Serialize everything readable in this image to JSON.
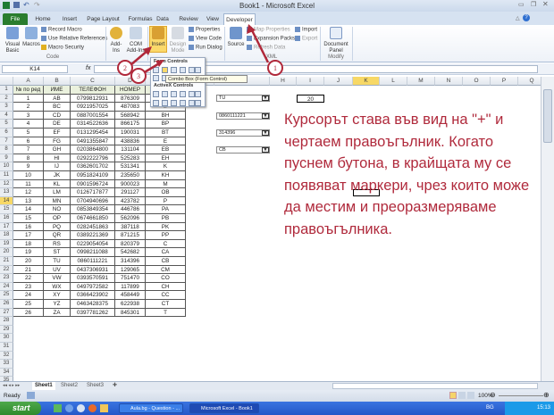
{
  "window": {
    "title": "Book1 - Microsoft Excel"
  },
  "tabs": [
    "File",
    "Home",
    "Insert",
    "Page Layout",
    "Formulas",
    "Data",
    "Review",
    "View",
    "Developer"
  ],
  "ribbon": {
    "code": {
      "visual_basic": "Visual Basic",
      "macros": "Macros",
      "record_macro": "Record Macro",
      "relative_refs": "Use Relative References",
      "macro_security": "Macro Security",
      "label": "Code"
    },
    "addins": {
      "addins": "Add-Ins",
      "com_addins": "COM Add-Ins",
      "label": "Add-Ins"
    },
    "controls": {
      "insert": "Insert",
      "design_mode": "Design Mode",
      "properties": "Properties",
      "view_code": "View Code",
      "run_dialog": "Run Dialog"
    },
    "xml": {
      "source": "Source",
      "map_properties": "Map Properties",
      "expansion_packs": "Expansion Packs",
      "refresh_data": "Refresh Data",
      "import": "Import",
      "export": "Export",
      "label": "XML"
    },
    "modify": {
      "document_panel": "Document Panel",
      "label": "Modify"
    }
  },
  "formula_bar": {
    "name_box": "K14",
    "fx": "fx",
    "value": ""
  },
  "popup": {
    "form_controls": "Form Controls",
    "activex": "ActiveX Controls",
    "tooltip": "Combo Box (Form Control)"
  },
  "columns": [
    "A",
    "B",
    "C",
    "D",
    "E",
    "F",
    "G",
    "H",
    "I",
    "J",
    "K",
    "L",
    "M",
    "N",
    "O",
    "P",
    "Q"
  ],
  "header_row": [
    "№ по ред",
    "ИМЕ",
    "ТЕЛЕФОН",
    "НОМЕР",
    ""
  ],
  "rows": [
    [
      "1",
      "AB",
      "0799812931",
      "876309",
      "А"
    ],
    [
      "2",
      "BC",
      "0921957025",
      "487083",
      "Б"
    ],
    [
      "3",
      "CD",
      "0887001554",
      "568942",
      "BH"
    ],
    [
      "4",
      "DE",
      "0314522636",
      "866175",
      "BP"
    ],
    [
      "5",
      "EF",
      "0131295454",
      "190031",
      "BT"
    ],
    [
      "6",
      "FG",
      "0491355847",
      "438836",
      "E"
    ],
    [
      "7",
      "GH",
      "0203864800",
      "131104",
      "EB"
    ],
    [
      "8",
      "HI",
      "0292222796",
      "525283",
      "EH"
    ],
    [
      "9",
      "IJ",
      "0362601702",
      "531341",
      "K"
    ],
    [
      "10",
      "JK",
      "0951824109",
      "235650",
      "KH"
    ],
    [
      "11",
      "KL",
      "0901596724",
      "900023",
      "M"
    ],
    [
      "12",
      "LM",
      "0126717877",
      "291127",
      "OB"
    ],
    [
      "13",
      "MN",
      "0704940696",
      "423782",
      "P"
    ],
    [
      "14",
      "NO",
      "0853849354",
      "446786",
      "PA"
    ],
    [
      "15",
      "OP",
      "0674661850",
      "562096",
      "PB"
    ],
    [
      "16",
      "PQ",
      "0282451863",
      "387118",
      "PK"
    ],
    [
      "17",
      "QR",
      "0389221369",
      "871215",
      "PP"
    ],
    [
      "18",
      "RS",
      "0229054054",
      "820379",
      "C"
    ],
    [
      "19",
      "ST",
      "0998211088",
      "542682",
      "CA"
    ],
    [
      "20",
      "TU",
      "0860111221",
      "314396",
      "CB"
    ],
    [
      "21",
      "UV",
      "0437306931",
      "129065",
      "CM"
    ],
    [
      "22",
      "VW",
      "0393570591",
      "751470",
      "CO"
    ],
    [
      "23",
      "WX",
      "0497972582",
      "117899",
      "CH"
    ],
    [
      "24",
      "XY",
      "0366423902",
      "458449",
      "CC"
    ],
    [
      "25",
      "YZ",
      "0463428375",
      "622938",
      "CT"
    ],
    [
      "26",
      "ZA",
      "0397781262",
      "845301",
      "T"
    ]
  ],
  "combos": [
    {
      "row": 2,
      "value": "TU"
    },
    {
      "row": 4,
      "value": "0860111221"
    },
    {
      "row": 6,
      "value": "314396"
    },
    {
      "row": 8,
      "value": "CB"
    }
  ],
  "cell_i2": "20",
  "annotation_text": "Курсорът  става във вид на  \"+\" и чертаем правоъгълник. Когато пуснем бутона, в крайщата му се появяват маркери, чрез които може да местим и преоразмеряваме правоъгълника.",
  "callouts": [
    "1",
    "2",
    "3"
  ],
  "sheets": [
    "Sheet1",
    "Sheet2",
    "Sheet3"
  ],
  "status": {
    "ready": "Ready",
    "zoom": "100%"
  },
  "taskbar": {
    "start": "start",
    "items": [
      "Aula.bg - Question - ...",
      "Microsoft Excel - Book1"
    ],
    "lang": "BG",
    "time": "15:13"
  },
  "colors": {
    "annotation": "#b02a3c",
    "accent_file": "#2a7d2e",
    "selection": "#f7d866"
  }
}
